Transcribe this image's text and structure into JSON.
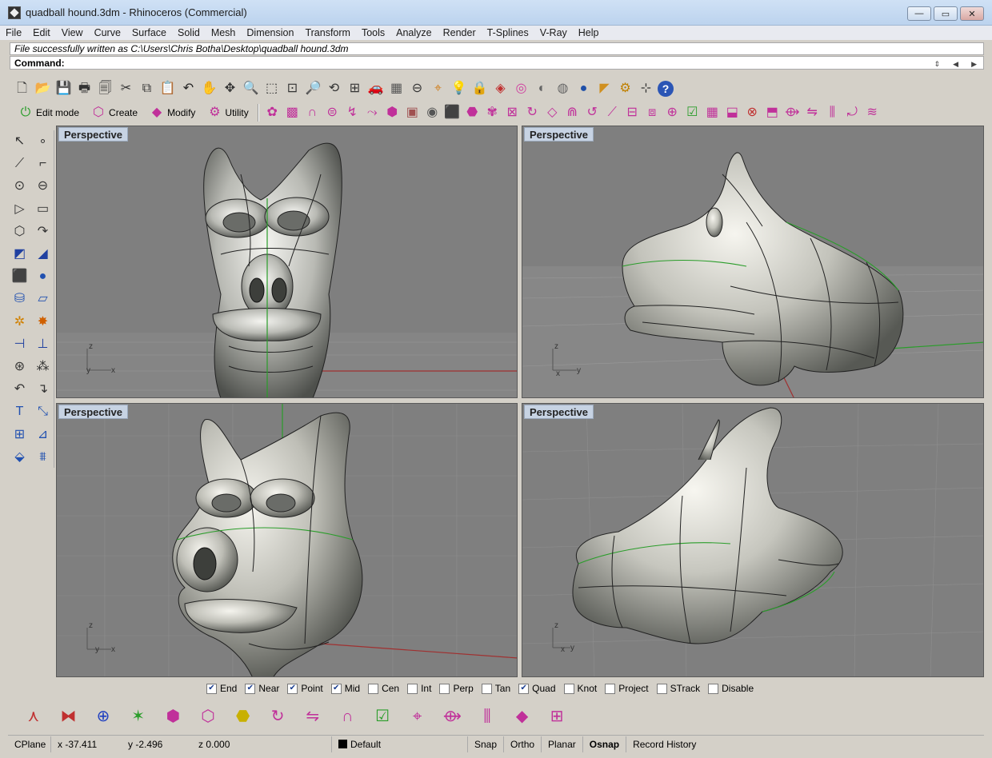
{
  "window": {
    "title": "quadball hound.3dm - Rhinoceros (Commercial)",
    "minimize": "—",
    "maximize": "▭",
    "close": "✕"
  },
  "menu": [
    "File",
    "Edit",
    "View",
    "Curve",
    "Surface",
    "Solid",
    "Mesh",
    "Dimension",
    "Transform",
    "Tools",
    "Analyze",
    "Render",
    "T-Splines",
    "V-Ray",
    "Help"
  ],
  "command": {
    "history": "File successfully written as C:\\Users\\Chris Botha\\Desktop\\quadball hound.3dm",
    "prompt": "Command:"
  },
  "toolbar_standard": [
    {
      "name": "new-icon",
      "glyph": "🗋",
      "color": "#333"
    },
    {
      "name": "open-icon",
      "glyph": "📂",
      "color": "#b08020"
    },
    {
      "name": "save-icon",
      "glyph": "💾",
      "color": "#334"
    },
    {
      "name": "print-icon",
      "glyph": "🖶",
      "color": "#333"
    },
    {
      "name": "export-icon",
      "glyph": "🗐",
      "color": "#333"
    },
    {
      "name": "cut-icon",
      "glyph": "✂",
      "color": "#333"
    },
    {
      "name": "copy-icon",
      "glyph": "⧉",
      "color": "#333"
    },
    {
      "name": "paste-icon",
      "glyph": "📋",
      "color": "#b08020"
    },
    {
      "name": "undo-icon",
      "glyph": "↶",
      "color": "#222"
    },
    {
      "name": "pan-icon",
      "glyph": "✋",
      "color": "#333"
    },
    {
      "name": "rotate-view-icon",
      "glyph": "✥",
      "color": "#333"
    },
    {
      "name": "zoom-dynamic-icon",
      "glyph": "🔍",
      "color": "#333"
    },
    {
      "name": "zoom-window-icon",
      "glyph": "⬚",
      "color": "#333"
    },
    {
      "name": "zoom-extents-icon",
      "glyph": "⊡",
      "color": "#333"
    },
    {
      "name": "zoom-selected-icon",
      "glyph": "🔎",
      "color": "#333"
    },
    {
      "name": "undo-view-icon",
      "glyph": "⟲",
      "color": "#333"
    },
    {
      "name": "four-viewports-icon",
      "glyph": "⊞",
      "color": "#333"
    },
    {
      "name": "car-icon",
      "glyph": "🚗",
      "color": "#c0302a"
    },
    {
      "name": "grid-plane-icon",
      "glyph": "▦",
      "color": "#555"
    },
    {
      "name": "distance-icon",
      "glyph": "⊖",
      "color": "#333"
    },
    {
      "name": "select-filter-icon",
      "glyph": "⌖",
      "color": "#d08020"
    },
    {
      "name": "light-bulb-icon",
      "glyph": "💡",
      "color": "#999"
    },
    {
      "name": "lock-icon",
      "glyph": "🔒",
      "color": "#333"
    },
    {
      "name": "layer-icon",
      "glyph": "◈",
      "color": "#c03030"
    },
    {
      "name": "color-wheel-icon",
      "glyph": "◎",
      "color": "#d040a0"
    },
    {
      "name": "wireframe-sphere-icon",
      "glyph": "◐",
      "color": "#666"
    },
    {
      "name": "shaded-sphere-icon",
      "glyph": "◍",
      "color": "#666"
    },
    {
      "name": "render-sphere-icon",
      "glyph": "●",
      "color": "#1f4fa8"
    },
    {
      "name": "analysis-icon",
      "glyph": "◤",
      "color": "#d09020"
    },
    {
      "name": "options-gear-icon",
      "glyph": "⚙",
      "color": "#c08000"
    },
    {
      "name": "group-icon",
      "glyph": "⊹",
      "color": "#333"
    },
    {
      "name": "help-icon",
      "glyph": "?",
      "color": "#ffffff",
      "bg": "#2b55b5"
    }
  ],
  "toolbar_tabs": [
    {
      "name": "edit-mode-tab",
      "glyph": "⏻",
      "color": "#2a9d2a",
      "label": "Edit mode"
    },
    {
      "name": "create-tab",
      "glyph": "⬡",
      "color": "#c0309a",
      "label": "Create"
    },
    {
      "name": "modify-tab",
      "glyph": "◆",
      "color": "#c0309a",
      "label": "Modify"
    },
    {
      "name": "utility-tab",
      "glyph": "⚙",
      "color": "#c0309a",
      "label": "Utility"
    }
  ],
  "toolbar_tsplines": [
    {
      "name": "tspline-prop-icon",
      "glyph": "✿",
      "color": "#c0309a"
    },
    {
      "name": "tspline-grid-icon",
      "glyph": "▩",
      "color": "#c0309a"
    },
    {
      "name": "tspline-arch-icon",
      "glyph": "∩",
      "color": "#c0309a"
    },
    {
      "name": "tspline-cylinder-icon",
      "glyph": "⊜",
      "color": "#c0309a"
    },
    {
      "name": "tspline-bend-icon",
      "glyph": "↯",
      "color": "#c0309a"
    },
    {
      "name": "tspline-curve-icon",
      "glyph": "⤳",
      "color": "#c0309a"
    },
    {
      "name": "tspline-sphere-icon",
      "glyph": "⬢",
      "color": "#c0309a"
    },
    {
      "name": "vray-material-icon",
      "glyph": "▣",
      "color": "#a05050"
    },
    {
      "name": "vray-render-icon",
      "glyph": "◉",
      "color": "#555"
    },
    {
      "name": "tspline-box-icon",
      "glyph": "⬛",
      "color": "#c0309a"
    },
    {
      "name": "tspline-quadball-icon",
      "glyph": "⬣",
      "color": "#c0309a"
    },
    {
      "name": "tspline-star-icon",
      "glyph": "✾",
      "color": "#c0309a"
    },
    {
      "name": "tspline-frame-icon",
      "glyph": "⊠",
      "color": "#c0309a"
    },
    {
      "name": "tspline-cycle-icon",
      "glyph": "↻",
      "color": "#c0309a"
    },
    {
      "name": "tspline-plane-icon",
      "glyph": "◇",
      "color": "#c0309a"
    },
    {
      "name": "tspline-bridge-icon",
      "glyph": "⋒",
      "color": "#c0309a"
    },
    {
      "name": "tspline-twist-icon",
      "glyph": "↺",
      "color": "#c0309a"
    },
    {
      "name": "tspline-crease-icon",
      "glyph": "⟋",
      "color": "#c0309a"
    },
    {
      "name": "tspline-insert-icon",
      "glyph": "⊟",
      "color": "#c0309a"
    },
    {
      "name": "tspline-split-icon",
      "glyph": "⧈",
      "color": "#c0309a"
    },
    {
      "name": "tspline-weld-icon",
      "glyph": "⊕",
      "color": "#c0309a"
    },
    {
      "name": "tspline-select-icon",
      "glyph": "☑",
      "color": "#2a9d2a"
    },
    {
      "name": "tspline-face-icon",
      "glyph": "▦",
      "color": "#c0309a"
    },
    {
      "name": "tspline-extrude-icon",
      "glyph": "⬓",
      "color": "#c0309a"
    },
    {
      "name": "tspline-delete-icon",
      "glyph": "⊗",
      "color": "#c03030"
    },
    {
      "name": "tspline-fill-icon",
      "glyph": "⬒",
      "color": "#c0309a"
    },
    {
      "name": "tspline-loop-icon",
      "glyph": "⟴",
      "color": "#c0309a"
    },
    {
      "name": "tspline-mirror-icon",
      "glyph": "⇋",
      "color": "#c0309a"
    },
    {
      "name": "tspline-thicken-icon",
      "glyph": "⫼",
      "color": "#c0309a"
    },
    {
      "name": "tspline-convert-icon",
      "glyph": "⤾",
      "color": "#c0309a"
    },
    {
      "name": "tspline-smooth-icon",
      "glyph": "≋",
      "color": "#c0309a"
    }
  ],
  "toolbar_left": [
    {
      "name": "select-arrow-icon",
      "glyph": "↖",
      "color": "#333"
    },
    {
      "name": "point-icon",
      "glyph": "∘",
      "color": "#333"
    },
    {
      "name": "polyline-icon",
      "glyph": "⟋",
      "color": "#333"
    },
    {
      "name": "curve-icon",
      "glyph": "⌐",
      "color": "#333"
    },
    {
      "name": "circle-icon",
      "glyph": "⊙",
      "color": "#333"
    },
    {
      "name": "ellipse-icon",
      "glyph": "⊖",
      "color": "#333"
    },
    {
      "name": "arc-icon",
      "glyph": "▷",
      "color": "#333"
    },
    {
      "name": "rectangle-icon",
      "glyph": "▭",
      "color": "#333"
    },
    {
      "name": "polygon-icon",
      "glyph": "⬡",
      "color": "#333"
    },
    {
      "name": "fillet-curve-icon",
      "glyph": "↷",
      "color": "#333"
    },
    {
      "name": "surface-corner-icon",
      "glyph": "◩",
      "color": "#2040a0"
    },
    {
      "name": "surface-sweep-icon",
      "glyph": "◢",
      "color": "#2040a0"
    },
    {
      "name": "solid-box-icon",
      "glyph": "⬛",
      "color": "#2050b0"
    },
    {
      "name": "solid-sphere-icon",
      "glyph": "●",
      "color": "#2050b0"
    },
    {
      "name": "solid-cylinder-icon",
      "glyph": "⛁",
      "color": "#2050b0"
    },
    {
      "name": "mesh-plane-icon",
      "glyph": "▱",
      "color": "#2050b0"
    },
    {
      "name": "transform-gear-icon",
      "glyph": "✲",
      "color": "#d08000"
    },
    {
      "name": "explode-icon",
      "glyph": "✸",
      "color": "#d06000"
    },
    {
      "name": "trim-icon",
      "glyph": "⊣",
      "color": "#2040a0"
    },
    {
      "name": "split-icon",
      "glyph": "⊥",
      "color": "#2040a0"
    },
    {
      "name": "boolean-union-icon",
      "glyph": "⊛",
      "color": "#333"
    },
    {
      "name": "boolean-split-icon",
      "glyph": "⁂",
      "color": "#333"
    },
    {
      "name": "join-curve-icon",
      "glyph": "↶",
      "color": "#333"
    },
    {
      "name": "rebuild-curve-icon",
      "glyph": "↴",
      "color": "#333"
    },
    {
      "name": "text-icon",
      "glyph": "T",
      "color": "#2050b0"
    },
    {
      "name": "dimension-icon",
      "glyph": "⤡",
      "color": "#2050b0"
    },
    {
      "name": "array-icon",
      "glyph": "⊞",
      "color": "#2050b0"
    },
    {
      "name": "edit-points-icon",
      "glyph": "⊿",
      "color": "#2050b0"
    },
    {
      "name": "block-icon",
      "glyph": "⬙",
      "color": "#2050b0"
    },
    {
      "name": "drafting-icon",
      "glyph": "⩩",
      "color": "#2050b0"
    }
  ],
  "viewports": [
    {
      "label": "Perspective"
    },
    {
      "label": "Perspective"
    },
    {
      "label": "Perspective"
    },
    {
      "label": "Perspective"
    }
  ],
  "axes": {
    "x": "x",
    "y": "y",
    "z": "z"
  },
  "osnap": [
    {
      "label": "End",
      "checked": true
    },
    {
      "label": "Near",
      "checked": true
    },
    {
      "label": "Point",
      "checked": true
    },
    {
      "label": "Mid",
      "checked": true
    },
    {
      "label": "Cen",
      "checked": false
    },
    {
      "label": "Int",
      "checked": false
    },
    {
      "label": "Perp",
      "checked": false
    },
    {
      "label": "Tan",
      "checked": false
    },
    {
      "label": "Quad",
      "checked": true
    },
    {
      "label": "Knot",
      "checked": false
    },
    {
      "label": "Project",
      "checked": false
    },
    {
      "label": "STrack",
      "checked": false
    },
    {
      "label": "Disable",
      "checked": false
    }
  ],
  "toolbar_bottom": [
    {
      "name": "gumball-axes-icon",
      "glyph": "⋏",
      "color": "#c03030"
    },
    {
      "name": "gumball-move-icon",
      "glyph": "⧓",
      "color": "#c03030"
    },
    {
      "name": "gumball-rotate-icon",
      "glyph": "⊕",
      "color": "#2040c0"
    },
    {
      "name": "gumball-scale-icon",
      "glyph": "✶",
      "color": "#2a9d2a"
    },
    {
      "name": "tspline-face-mode-icon",
      "glyph": "⬢",
      "color": "#c0309a"
    },
    {
      "name": "tspline-edge-mode-icon",
      "glyph": "⬡",
      "color": "#c0309a"
    },
    {
      "name": "tspline-vertex-mode-icon",
      "glyph": "⬣",
      "color": "#c8b000"
    },
    {
      "name": "tspline-cycle-mode-icon",
      "glyph": "↻",
      "color": "#c0309a"
    },
    {
      "name": "tspline-transform-icon",
      "glyph": "⇋",
      "color": "#c0309a"
    },
    {
      "name": "tspline-loop-mode-icon",
      "glyph": "∩",
      "color": "#c0309a"
    },
    {
      "name": "tspline-select-mode-icon",
      "glyph": "☑",
      "color": "#2a9d2a"
    },
    {
      "name": "tspline-manipulator-icon",
      "glyph": "⌖",
      "color": "#c0309a"
    },
    {
      "name": "tspline-extrude-mode-icon",
      "glyph": "⟴",
      "color": "#c0309a"
    },
    {
      "name": "tspline-bridge-mode-icon",
      "glyph": "⫼",
      "color": "#c0309a"
    },
    {
      "name": "tspline-insert-mode-icon",
      "glyph": "◆",
      "color": "#c0309a"
    },
    {
      "name": "tspline-grid-mode-icon",
      "glyph": "⊞",
      "color": "#c0309a"
    }
  ],
  "status": {
    "cplane": "CPlane",
    "x": "x -37.411",
    "y": "y -2.496",
    "z": "z 0.000",
    "layer": "Default",
    "snap": "Snap",
    "ortho": "Ortho",
    "planar": "Planar",
    "osnap": "Osnap",
    "record": "Record History"
  }
}
